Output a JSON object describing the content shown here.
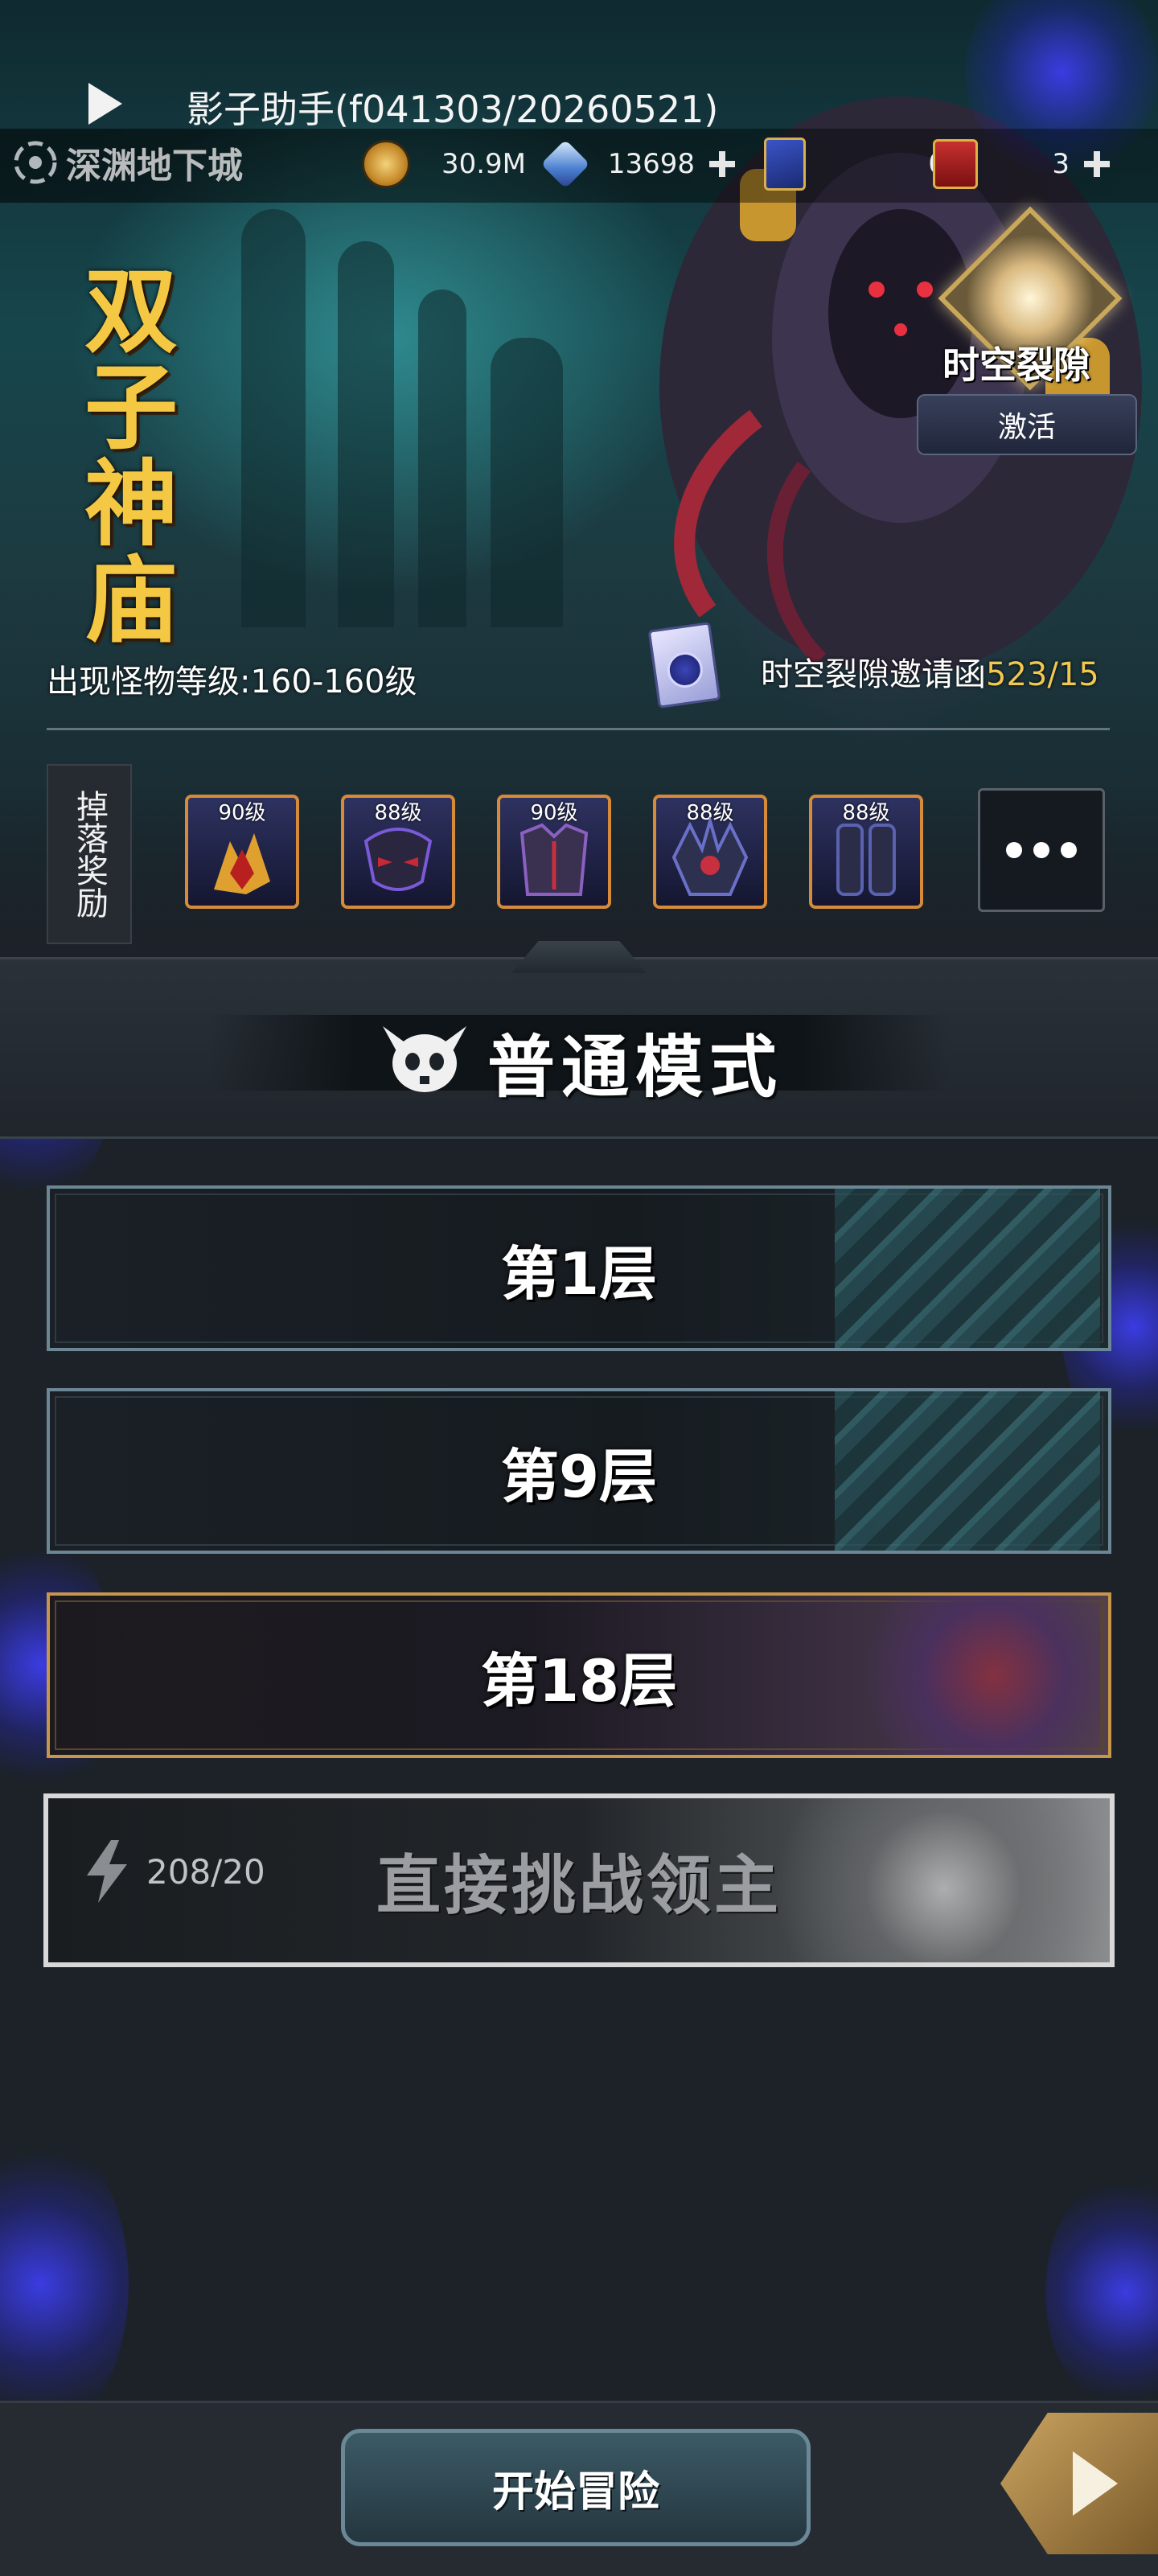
{
  "app": {
    "title": "影子助手(f041303/20260521)"
  },
  "header": {
    "dungeon_name": "深渊地下城",
    "resources": [
      {
        "name": "gold",
        "icon": "gold-coin-icon",
        "value": "30.9M",
        "has_plus": false
      },
      {
        "name": "crystal",
        "icon": "crystal-icon",
        "value": "13698",
        "has_plus": true
      },
      {
        "name": "card",
        "icon": "card-icon",
        "value": "0",
        "has_plus": false
      },
      {
        "name": "gold-box",
        "icon": "gold-box-icon",
        "value": "3",
        "has_plus": true
      }
    ]
  },
  "banner": {
    "dungeon_title": "双子神庙",
    "rift": {
      "label": "时空裂隙",
      "activate_label": "激活"
    },
    "monster_level": "出现怪物等级:160-160级",
    "invite": {
      "label": "时空裂隙邀请函",
      "count": "523/15"
    }
  },
  "drops": {
    "label": "掉落奖励",
    "items": [
      {
        "level": "90级",
        "icon": "golden-claw-gauntlet-icon",
        "color": "#e0a030"
      },
      {
        "level": "88级",
        "icon": "dark-demon-helm-icon",
        "color": "#7a5ad8"
      },
      {
        "level": "90级",
        "icon": "shadow-armor-icon",
        "color": "#8a60c0"
      },
      {
        "level": "88级",
        "icon": "spiked-pauldron-icon",
        "color": "#6a70c8"
      },
      {
        "level": "88级",
        "icon": "dark-greaves-icon",
        "color": "#5a62b0"
      }
    ],
    "more_label": "more-items"
  },
  "mode": {
    "title": "普通模式",
    "icon": "demon-skull-icon"
  },
  "floors": [
    {
      "label": "第1层",
      "style": "teal"
    },
    {
      "label": "第9层",
      "style": "teal"
    },
    {
      "label": "第18层",
      "style": "gold"
    }
  ],
  "boss": {
    "label": "直接挑战领主",
    "energy": "208/20",
    "energy_icon": "lightning-icon"
  },
  "footer": {
    "start_label": "开始冒险",
    "next_icon": "next-arrow-icon"
  },
  "colors": {
    "accent_gold": "#f4c842",
    "invite_count": "#f0c850",
    "floor_border": "#6b8796",
    "floor_gold_border": "#c8964a"
  }
}
